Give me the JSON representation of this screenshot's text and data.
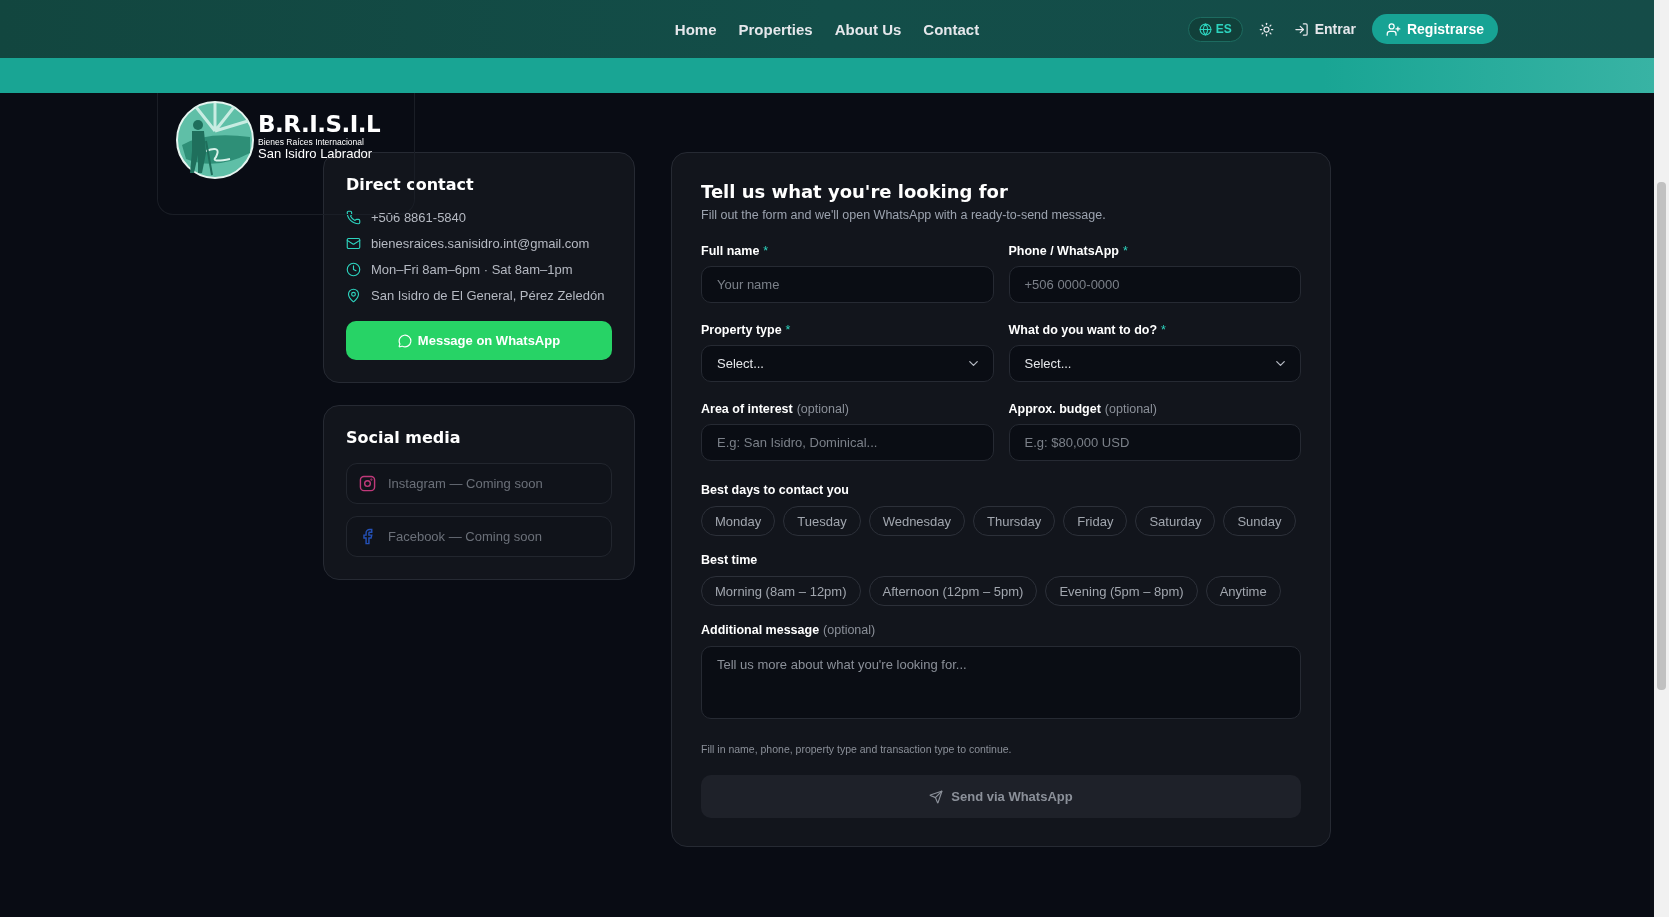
{
  "nav": {
    "links": [
      {
        "label": "Home"
      },
      {
        "label": "Properties"
      },
      {
        "label": "About Us"
      },
      {
        "label": "Contact"
      }
    ],
    "language": "ES",
    "login": "Entrar",
    "register": "Registrarse"
  },
  "logo": {
    "name": "B.R.I.S.I.L",
    "tagline": "Bienes Raíces Internacional",
    "subtitle": "San Isidro Labrador"
  },
  "direct_contact": {
    "title": "Direct contact",
    "items": [
      {
        "kind": "phone",
        "text": "+506 8861-5840"
      },
      {
        "kind": "email",
        "text": "bienesraices.sanisidro.int@gmail.com"
      },
      {
        "kind": "hours",
        "text": "Mon–Fri 8am–6pm · Sat 8am–1pm"
      },
      {
        "kind": "location",
        "text": "San Isidro de El General, Pérez Zeledón"
      }
    ],
    "button": "Message on WhatsApp"
  },
  "social_media": {
    "title": "Social media",
    "items": [
      {
        "kind": "instagram",
        "text": "Instagram — Coming soon"
      },
      {
        "kind": "facebook",
        "text": "Facebook — Coming soon"
      }
    ]
  },
  "form": {
    "title": "Tell us what you're looking for",
    "subtitle": "Fill out the form and we'll open WhatsApp with a ready-to-send message.",
    "fields": [
      {
        "kind": "input",
        "label": "Full name",
        "mark": "*",
        "placeholder": "Your name"
      },
      {
        "kind": "input",
        "label": "Phone / WhatsApp",
        "mark": "*",
        "placeholder": "+506 0000-0000"
      },
      {
        "kind": "select",
        "label": "Property type",
        "mark": "*",
        "value": "Select..."
      },
      {
        "kind": "select",
        "label": "What do you want to do?",
        "mark": "*",
        "value": "Select..."
      },
      {
        "kind": "input",
        "label": "Area of interest",
        "note": "(optional)",
        "placeholder": "E.g: San Isidro, Dominical..."
      },
      {
        "kind": "input",
        "label": "Approx. budget",
        "note": "(optional)",
        "placeholder": "E.g: $80,000 USD"
      }
    ],
    "days": {
      "label": "Best days to contact you",
      "options": [
        {
          "label": "Monday",
          "selected": false
        },
        {
          "label": "Tuesday",
          "selected": false
        },
        {
          "label": "Wednesday",
          "selected": false
        },
        {
          "label": "Thursday",
          "selected": false
        },
        {
          "label": "Friday",
          "selected": false
        },
        {
          "label": "Saturday",
          "selected": false
        },
        {
          "label": "Sunday",
          "selected": false
        }
      ]
    },
    "times": {
      "label": "Best time",
      "options": [
        {
          "label": "Morning (8am – 12pm)",
          "selected": false
        },
        {
          "label": "Afternoon (12pm – 5pm)",
          "selected": false
        },
        {
          "label": "Evening (5pm – 8pm)",
          "selected": false
        },
        {
          "label": "Anytime",
          "selected": false
        }
      ]
    },
    "message": {
      "label": "Additional message",
      "note": "(optional)",
      "placeholder": "Tell us more about what you're looking for..."
    },
    "hint": "Fill in name, phone, property type and transaction type to continue.",
    "submit": {
      "label": "Send via WhatsApp",
      "disabled": true
    }
  }
}
